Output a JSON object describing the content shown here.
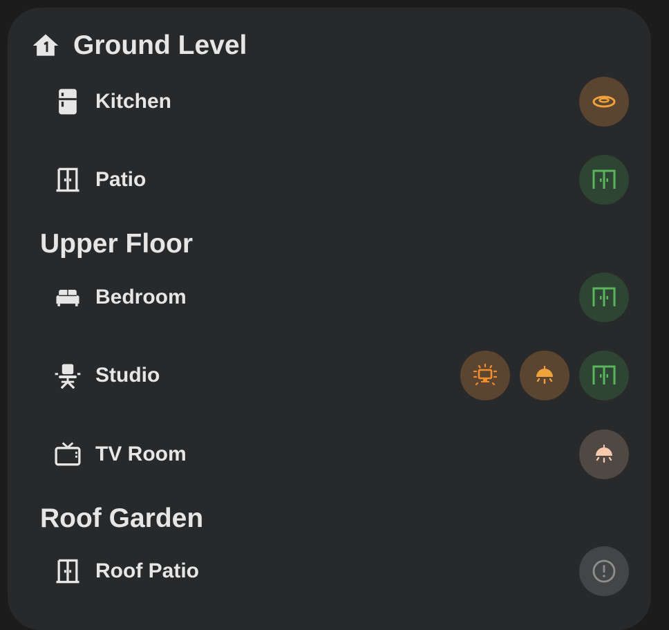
{
  "floors": [
    {
      "name": "Ground Level",
      "icon": "home-floor-1-icon",
      "rooms": [
        {
          "name": "Kitchen",
          "icon": "fridge-icon",
          "badges": [
            {
              "icon": "ceiling-light-ring-icon",
              "color": "#f0a33c"
            }
          ]
        },
        {
          "name": "Patio",
          "icon": "door-icon",
          "badges": [
            {
              "icon": "window-closed-icon",
              "color": "#5bb55f"
            }
          ]
        }
      ]
    },
    {
      "name": "Upper Floor",
      "rooms": [
        {
          "name": "Bedroom",
          "icon": "bed-icon",
          "badges": [
            {
              "icon": "window-closed-icon",
              "color": "#5bb55f"
            }
          ]
        },
        {
          "name": "Studio",
          "icon": "office-chair-icon",
          "badges": [
            {
              "icon": "monitor-glow-icon",
              "color": "#f28e2b"
            },
            {
              "icon": "ceiling-lamp-icon",
              "color": "#f0a33c"
            },
            {
              "icon": "window-closed-icon",
              "color": "#5bb55f"
            }
          ]
        },
        {
          "name": "TV Room",
          "icon": "television-icon",
          "badges": [
            {
              "icon": "ceiling-lamp-icon",
              "color": "#f7c9ad"
            }
          ]
        }
      ]
    },
    {
      "name": "Roof Garden",
      "rooms": [
        {
          "name": "Roof Patio",
          "icon": "door-icon",
          "badges": [
            {
              "icon": "alert-circle-icon",
              "color": "#8e8e8e"
            }
          ]
        }
      ]
    }
  ]
}
